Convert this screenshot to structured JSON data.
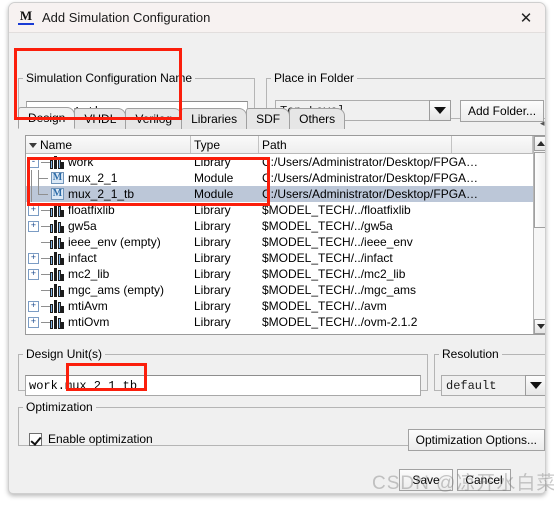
{
  "window": {
    "title": "Add Simulation Configuration",
    "icon": "modelsim-m-icon",
    "close_label": "✕"
  },
  "sim_name_group": {
    "legend": "Simulation Configuration Name",
    "value": "mux_2_1_tb",
    "placeholder": ""
  },
  "place_in_folder_group": {
    "legend": "Place in Folder",
    "selected": "Top Level",
    "add_folder_label": "Add Folder..."
  },
  "tabs": [
    {
      "label": "Design",
      "selected": true
    },
    {
      "label": "VHDL",
      "selected": false
    },
    {
      "label": "Verilog",
      "selected": false
    },
    {
      "label": "Libraries",
      "selected": false
    },
    {
      "label": "SDF",
      "selected": false
    },
    {
      "label": "Others",
      "selected": false
    }
  ],
  "tab_scroller": {
    "left": "◂",
    "right": "▸"
  },
  "tree": {
    "columns": [
      "Name",
      "Type",
      "Path",
      ""
    ],
    "rows": [
      {
        "name": "work",
        "type": "Library",
        "path": "C:/Users/Administrator/Desktop/FPGA…",
        "depth": 0,
        "icon": "library-icon",
        "expander": "-",
        "selected": false
      },
      {
        "name": "mux_2_1",
        "type": "Module",
        "path": "C:/Users/Administrator/Desktop/FPGA…",
        "depth": 1,
        "icon": "module-icon",
        "expander": "",
        "selected": false
      },
      {
        "name": "mux_2_1_tb",
        "type": "Module",
        "path": "C:/Users/Administrator/Desktop/FPGA…",
        "depth": 1,
        "icon": "module-icon",
        "expander": "",
        "selected": true
      },
      {
        "name": "floatfixlib",
        "type": "Library",
        "path": "$MODEL_TECH/../floatfixlib",
        "depth": 0,
        "icon": "library-icon",
        "expander": "+",
        "selected": false
      },
      {
        "name": "gw5a",
        "type": "Library",
        "path": "$MODEL_TECH/../gw5a",
        "depth": 0,
        "icon": "library-icon",
        "expander": "+",
        "selected": false
      },
      {
        "name": "ieee_env  (empty)",
        "type": "Library",
        "path": "$MODEL_TECH/../ieee_env",
        "depth": 0,
        "icon": "library-icon",
        "expander": "",
        "selected": false
      },
      {
        "name": "infact",
        "type": "Library",
        "path": "$MODEL_TECH/../infact",
        "depth": 0,
        "icon": "library-icon",
        "expander": "+",
        "selected": false
      },
      {
        "name": "mc2_lib",
        "type": "Library",
        "path": "$MODEL_TECH/../mc2_lib",
        "depth": 0,
        "icon": "library-icon",
        "expander": "+",
        "selected": false
      },
      {
        "name": "mgc_ams  (empty)",
        "type": "Library",
        "path": "$MODEL_TECH/../mgc_ams",
        "depth": 0,
        "icon": "library-icon",
        "expander": "",
        "selected": false
      },
      {
        "name": "mtiAvm",
        "type": "Library",
        "path": "$MODEL_TECH/../avm",
        "depth": 0,
        "icon": "library-icon",
        "expander": "+",
        "selected": false
      },
      {
        "name": "mtiOvm",
        "type": "Library",
        "path": "$MODEL_TECH/../ovm-2.1.2",
        "depth": 0,
        "icon": "library-icon",
        "expander": "+",
        "selected": false
      }
    ]
  },
  "design_units_group": {
    "legend": "Design Unit(s)",
    "value": "work.mux_2_1_tb"
  },
  "resolution_group": {
    "legend": "Resolution",
    "selected": "default"
  },
  "optimization_group": {
    "legend": "Optimization",
    "checkbox_label": "Enable optimization",
    "checked": true,
    "options_button": "Optimization Options..."
  },
  "footer": {
    "save_label": "Save",
    "cancel_label": "Cancel"
  },
  "watermark": {
    "text": "CSDN @凉开水白菜"
  },
  "annotation_color": "#fb1e0b"
}
